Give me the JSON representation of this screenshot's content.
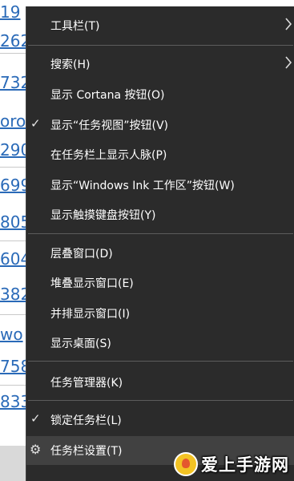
{
  "menu": {
    "items": [
      {
        "label": "工具栏(T)",
        "checked": false,
        "submenu": true
      },
      {
        "label": "搜索(H)",
        "checked": false,
        "submenu": true
      },
      {
        "label": "显示 Cortana 按钮(O)",
        "checked": false,
        "submenu": false
      },
      {
        "label": "显示“任务视图”按钮(V)",
        "checked": true,
        "submenu": false
      },
      {
        "label": "在任务栏上显示人脉(P)",
        "checked": false,
        "submenu": false
      },
      {
        "label": "显示“Windows Ink 工作区”按钮(W)",
        "checked": false,
        "submenu": false
      },
      {
        "label": "显示触摸键盘按钮(Y)",
        "checked": false,
        "submenu": false
      },
      {
        "label": "层叠窗口(D)",
        "checked": false,
        "submenu": false
      },
      {
        "label": "堆叠显示窗口(E)",
        "checked": false,
        "submenu": false
      },
      {
        "label": "并排显示窗口(I)",
        "checked": false,
        "submenu": false
      },
      {
        "label": "显示桌面(S)",
        "checked": false,
        "submenu": false
      },
      {
        "label": "任务管理器(K)",
        "checked": false,
        "submenu": false
      },
      {
        "label": "锁定任务栏(L)",
        "checked": true,
        "submenu": false
      },
      {
        "label": "任务栏设置(T)",
        "checked": false,
        "submenu": false,
        "icon": "gear-icon",
        "highlighted": true
      }
    ]
  },
  "background": {
    "fragments": [
      "19",
      "262",
      "732",
      "oro",
      "290",
      "699",
      "805",
      "604",
      "382",
      "wo",
      "758",
      "833"
    ]
  },
  "watermark": {
    "text": "爱上手游网"
  },
  "colors": {
    "menu_bg": "#2b2b2b",
    "highlight": "#414141",
    "separator": "#5c5c5c",
    "link": "#2a6ab8"
  }
}
